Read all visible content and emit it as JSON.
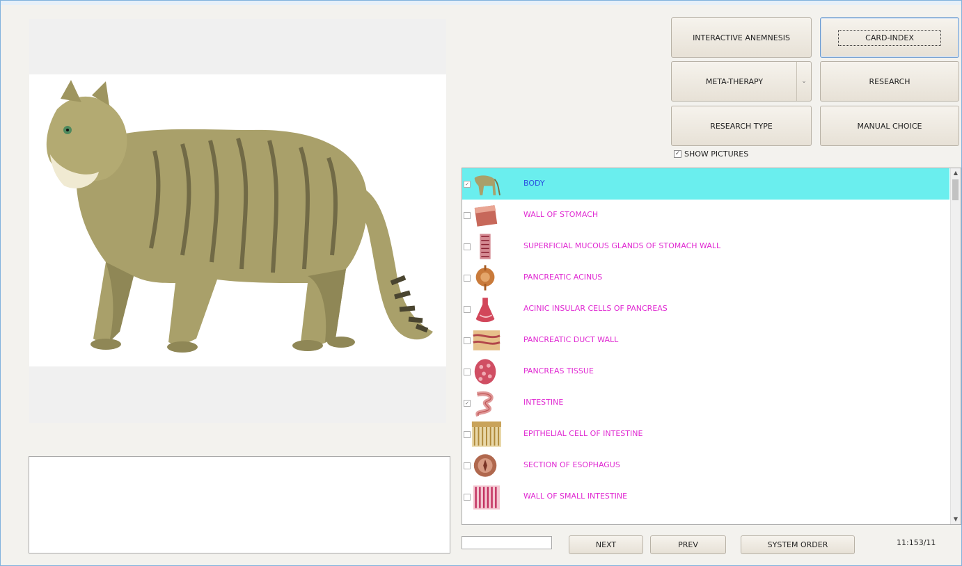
{
  "buttons": {
    "interactive_anemnesis": "INTERACTIVE ANEMNESIS",
    "card_index": "CARD-INDEX",
    "meta_therapy": "META-THERAPY",
    "research": "RESEARCH",
    "research_type": "RESEARCH TYPE",
    "manual_choice": "MANUAL CHOICE",
    "next": "NEXT",
    "prev": "PREV",
    "system_order": "SYSTEM ORDER"
  },
  "show_pictures": {
    "label": "SHOW PICTURES",
    "checked": true
  },
  "list": {
    "items": [
      {
        "label": "BODY",
        "checked": true,
        "selected": true,
        "thumb": "cat-thumb"
      },
      {
        "label": "WALL OF STOMACH",
        "checked": false,
        "selected": false,
        "thumb": "stomach-wall-thumb"
      },
      {
        "label": "SUPERFICIAL MUCOUS GLANDS OF STOMACH WALL",
        "checked": false,
        "selected": false,
        "thumb": "glands-thumb"
      },
      {
        "label": "PANCREATIC ACINUS",
        "checked": false,
        "selected": false,
        "thumb": "acinus-thumb"
      },
      {
        "label": "ACINIC INSULAR CELLS OF PANCREAS",
        "checked": false,
        "selected": false,
        "thumb": "insular-thumb"
      },
      {
        "label": "PANCREATIC DUCT WALL",
        "checked": false,
        "selected": false,
        "thumb": "duct-thumb"
      },
      {
        "label": "PANCREAS  TISSUE",
        "checked": false,
        "selected": false,
        "thumb": "tissue-thumb"
      },
      {
        "label": "INTESTINE",
        "checked": true,
        "selected": false,
        "thumb": "intestine-thumb"
      },
      {
        "label": "EPITHELIAL CELL OF INTESTINE",
        "checked": false,
        "selected": false,
        "thumb": "epithelial-thumb"
      },
      {
        "label": "SECTION OF ESOPHAGUS",
        "checked": false,
        "selected": false,
        "thumb": "esophagus-thumb"
      },
      {
        "label": "WALL  OF  SMALL  INTESTINE",
        "checked": false,
        "selected": false,
        "thumb": "small-intestine-thumb"
      }
    ]
  },
  "counter": "11:153/11",
  "search_value": "",
  "notes_value": "",
  "colors": {
    "selection": "#6aeeee",
    "item_text": "#e02ad2",
    "selected_text": "#2a4fe0"
  }
}
